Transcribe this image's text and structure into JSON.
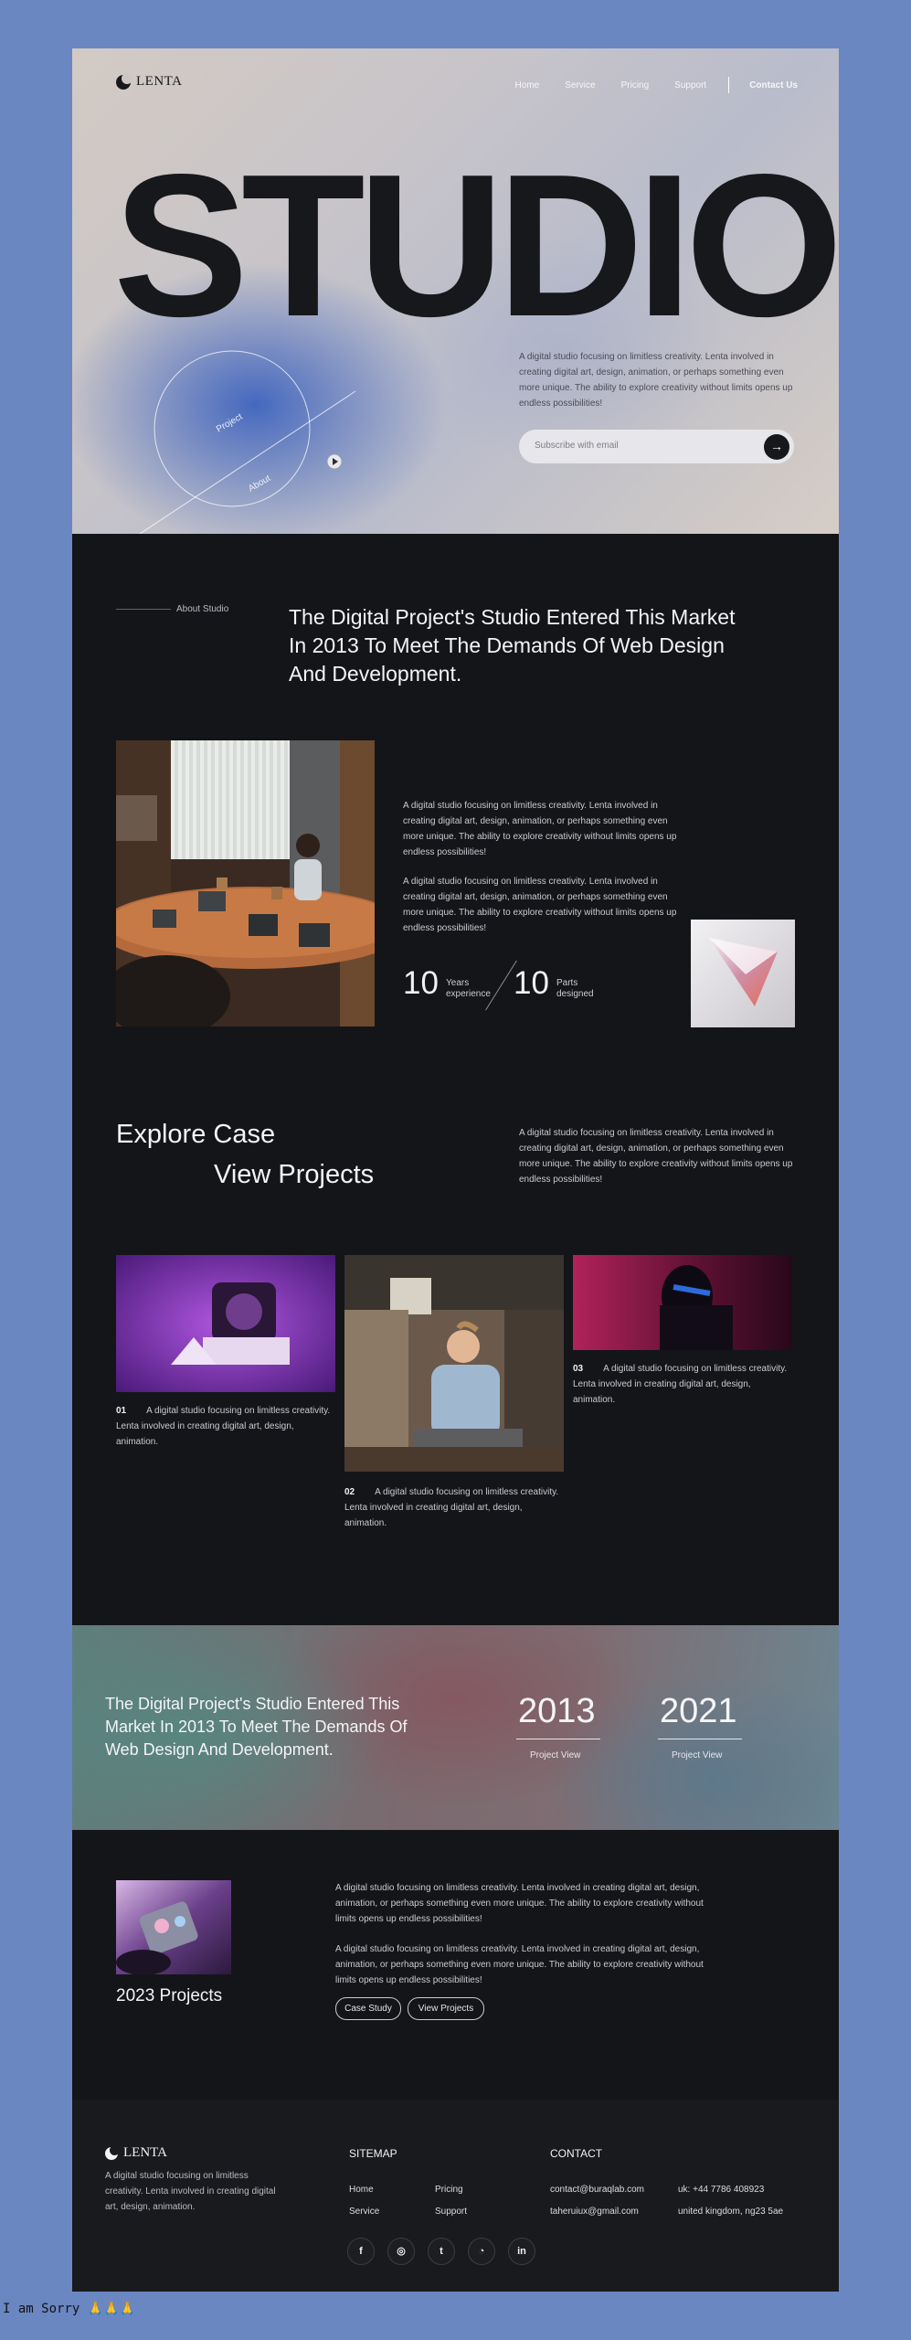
{
  "brand": {
    "name": "LENTA"
  },
  "nav": {
    "items": [
      "Home",
      "Service",
      "Pricing",
      "Support"
    ],
    "contact": "Contact Us"
  },
  "hero": {
    "title": "STUDIO",
    "circle_labels": [
      "Project",
      "About"
    ],
    "description": "A digital studio focusing on limitless creativity. Lenta involved in creating digital art, design, animation, or perhaps something even more unique. The ability to explore creativity without limits opens up endless possibilities!",
    "subscribe_placeholder": "Subscribe with email"
  },
  "about": {
    "label": "About Studio",
    "headline": "The Digital Project's Studio Entered This Market In 2013 To Meet The Demands Of Web Design And Development.",
    "paragraph1": "A digital studio focusing on limitless creativity. Lenta involved in creating digital art, design, animation, or perhaps something even more unique. The ability to explore creativity without limits opens up endless possibilities!",
    "paragraph2": "A digital studio focusing on limitless creativity. Lenta involved in creating digital art, design, animation, or perhaps something even more unique. The ability to explore creativity without limits opens up endless possibilities!",
    "stats": [
      {
        "value": "10",
        "label_line1": "Years",
        "label_line2": "experience"
      },
      {
        "value": "10",
        "label_line1": "Parts",
        "label_line2": "designed"
      }
    ]
  },
  "explore": {
    "line1": "Explore Case",
    "line2": "View Projects",
    "description": "A digital studio focusing on limitless creativity. Lenta involved in creating digital art, design, animation, or perhaps something even more unique. The ability to explore creativity without limits opens up endless possibilities!",
    "projects": [
      {
        "num": "01",
        "text": "A digital studio focusing on limitless creativity. Lenta involved in creating digital art, design, animation."
      },
      {
        "num": "02",
        "text": "A digital studio focusing on limitless creativity. Lenta involved in creating digital art, design, animation."
      },
      {
        "num": "03",
        "text": "A digital studio focusing on limitless creativity. Lenta involved in creating digital art, design, animation."
      }
    ]
  },
  "banner": {
    "text": "The Digital Project's Studio Entered This Market In 2013 To Meet The Demands Of Web Design And Development.",
    "years": [
      {
        "year": "2013",
        "label": "Project View"
      },
      {
        "year": "2021",
        "label": "Project View"
      }
    ]
  },
  "projects2023": {
    "title": "2023 Projects",
    "paragraph1": "A digital studio focusing on limitless creativity. Lenta involved in creating digital art, design, animation, or perhaps something even more unique. The ability to explore creativity without limits opens up endless possibilities!",
    "paragraph2": "A digital studio focusing on limitless creativity. Lenta involved in creating digital art, design, animation, or perhaps something even more unique. The ability to explore creativity without limits opens up endless possibilities!",
    "buttons": [
      "Case Study",
      "View Projects"
    ]
  },
  "footer": {
    "brand": "LENTA",
    "description": "A digital studio focusing on limitless creativity. Lenta involved in creating digital art, design, animation.",
    "sitemap_title": "SITEMAP",
    "sitemap": [
      "Home",
      "Pricing",
      "Service",
      "Support"
    ],
    "contact_title": "CONTACT",
    "contacts": [
      "contact@buraqlab.com",
      "uk: +44 7786 408923",
      "taheruiux@gmail.com",
      "united kingdom, ng23 5ae"
    ],
    "social_icons": [
      "facebook-icon",
      "instagram-icon",
      "twitter-icon",
      "github-icon",
      "linkedin-icon"
    ]
  },
  "overlay_text": "I am Sorry 🙏🙏🙏"
}
